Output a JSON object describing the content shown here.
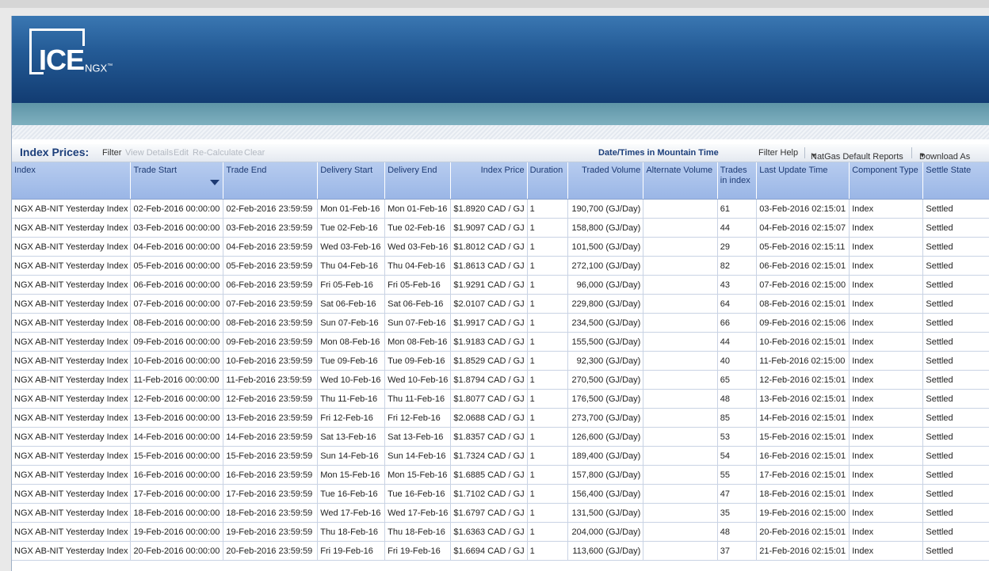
{
  "brand": {
    "name": "ICE",
    "sub": "NGX",
    "mark": "™"
  },
  "toolbar": {
    "title": "Index Prices:",
    "filter": "Filter",
    "view_details": "View Details",
    "edit": "Edit",
    "recalculate": "Re-Calculate",
    "clear": "Clear",
    "timezone_note": "Date/Times in Mountain Time",
    "filter_help": "Filter Help",
    "reports": "NatGas Default Reports",
    "download": "Download As"
  },
  "columns": [
    "Index",
    "Trade Start",
    "Trade End",
    "Delivery Start",
    "Delivery End",
    "Index Price",
    "Duration",
    "Traded Volume",
    "Alternate Volume",
    "Trades in index",
    "Last Update Time",
    "Component Type",
    "Settle State"
  ],
  "rows": [
    [
      "NGX AB-NIT Yesterday Index",
      "02-Feb-2016 00:00:00",
      "02-Feb-2016 23:59:59",
      "Mon 01-Feb-16",
      "Mon 01-Feb-16",
      "$1.8920 CAD / GJ",
      "1",
      "190,700 (GJ/Day)",
      "",
      "61",
      "03-Feb-2016 02:15:01",
      "Index",
      "Settled"
    ],
    [
      "NGX AB-NIT Yesterday Index",
      "03-Feb-2016 00:00:00",
      "03-Feb-2016 23:59:59",
      "Tue 02-Feb-16",
      "Tue 02-Feb-16",
      "$1.9097 CAD / GJ",
      "1",
      "158,800 (GJ/Day)",
      "",
      "44",
      "04-Feb-2016 02:15:07",
      "Index",
      "Settled"
    ],
    [
      "NGX AB-NIT Yesterday Index",
      "04-Feb-2016 00:00:00",
      "04-Feb-2016 23:59:59",
      "Wed 03-Feb-16",
      "Wed 03-Feb-16",
      "$1.8012 CAD / GJ",
      "1",
      "101,500 (GJ/Day)",
      "",
      "29",
      "05-Feb-2016 02:15:11",
      "Index",
      "Settled"
    ],
    [
      "NGX AB-NIT Yesterday Index",
      "05-Feb-2016 00:00:00",
      "05-Feb-2016 23:59:59",
      "Thu 04-Feb-16",
      "Thu 04-Feb-16",
      "$1.8613 CAD / GJ",
      "1",
      "272,100 (GJ/Day)",
      "",
      "82",
      "06-Feb-2016 02:15:01",
      "Index",
      "Settled"
    ],
    [
      "NGX AB-NIT Yesterday Index",
      "06-Feb-2016 00:00:00",
      "06-Feb-2016 23:59:59",
      "Fri 05-Feb-16",
      "Fri 05-Feb-16",
      "$1.9291 CAD / GJ",
      "1",
      "96,000 (GJ/Day)",
      "",
      "43",
      "07-Feb-2016 02:15:00",
      "Index",
      "Settled"
    ],
    [
      "NGX AB-NIT Yesterday Index",
      "07-Feb-2016 00:00:00",
      "07-Feb-2016 23:59:59",
      "Sat 06-Feb-16",
      "Sat 06-Feb-16",
      "$2.0107 CAD / GJ",
      "1",
      "229,800 (GJ/Day)",
      "",
      "64",
      "08-Feb-2016 02:15:01",
      "Index",
      "Settled"
    ],
    [
      "NGX AB-NIT Yesterday Index",
      "08-Feb-2016 00:00:00",
      "08-Feb-2016 23:59:59",
      "Sun 07-Feb-16",
      "Sun 07-Feb-16",
      "$1.9917 CAD / GJ",
      "1",
      "234,500 (GJ/Day)",
      "",
      "66",
      "09-Feb-2016 02:15:06",
      "Index",
      "Settled"
    ],
    [
      "NGX AB-NIT Yesterday Index",
      "09-Feb-2016 00:00:00",
      "09-Feb-2016 23:59:59",
      "Mon 08-Feb-16",
      "Mon 08-Feb-16",
      "$1.9183 CAD / GJ",
      "1",
      "155,500 (GJ/Day)",
      "",
      "44",
      "10-Feb-2016 02:15:01",
      "Index",
      "Settled"
    ],
    [
      "NGX AB-NIT Yesterday Index",
      "10-Feb-2016 00:00:00",
      "10-Feb-2016 23:59:59",
      "Tue 09-Feb-16",
      "Tue 09-Feb-16",
      "$1.8529 CAD / GJ",
      "1",
      "92,300 (GJ/Day)",
      "",
      "40",
      "11-Feb-2016 02:15:00",
      "Index",
      "Settled"
    ],
    [
      "NGX AB-NIT Yesterday Index",
      "11-Feb-2016 00:00:00",
      "11-Feb-2016 23:59:59",
      "Wed 10-Feb-16",
      "Wed 10-Feb-16",
      "$1.8794 CAD / GJ",
      "1",
      "270,500 (GJ/Day)",
      "",
      "65",
      "12-Feb-2016 02:15:01",
      "Index",
      "Settled"
    ],
    [
      "NGX AB-NIT Yesterday Index",
      "12-Feb-2016 00:00:00",
      "12-Feb-2016 23:59:59",
      "Thu 11-Feb-16",
      "Thu 11-Feb-16",
      "$1.8077 CAD / GJ",
      "1",
      "176,500 (GJ/Day)",
      "",
      "48",
      "13-Feb-2016 02:15:01",
      "Index",
      "Settled"
    ],
    [
      "NGX AB-NIT Yesterday Index",
      "13-Feb-2016 00:00:00",
      "13-Feb-2016 23:59:59",
      "Fri 12-Feb-16",
      "Fri 12-Feb-16",
      "$2.0688 CAD / GJ",
      "1",
      "273,700 (GJ/Day)",
      "",
      "85",
      "14-Feb-2016 02:15:01",
      "Index",
      "Settled"
    ],
    [
      "NGX AB-NIT Yesterday Index",
      "14-Feb-2016 00:00:00",
      "14-Feb-2016 23:59:59",
      "Sat 13-Feb-16",
      "Sat 13-Feb-16",
      "$1.8357 CAD / GJ",
      "1",
      "126,600 (GJ/Day)",
      "",
      "53",
      "15-Feb-2016 02:15:01",
      "Index",
      "Settled"
    ],
    [
      "NGX AB-NIT Yesterday Index",
      "15-Feb-2016 00:00:00",
      "15-Feb-2016 23:59:59",
      "Sun 14-Feb-16",
      "Sun 14-Feb-16",
      "$1.7324 CAD / GJ",
      "1",
      "189,400 (GJ/Day)",
      "",
      "54",
      "16-Feb-2016 02:15:01",
      "Index",
      "Settled"
    ],
    [
      "NGX AB-NIT Yesterday Index",
      "16-Feb-2016 00:00:00",
      "16-Feb-2016 23:59:59",
      "Mon 15-Feb-16",
      "Mon 15-Feb-16",
      "$1.6885 CAD / GJ",
      "1",
      "157,800 (GJ/Day)",
      "",
      "55",
      "17-Feb-2016 02:15:01",
      "Index",
      "Settled"
    ],
    [
      "NGX AB-NIT Yesterday Index",
      "17-Feb-2016 00:00:00",
      "17-Feb-2016 23:59:59",
      "Tue 16-Feb-16",
      "Tue 16-Feb-16",
      "$1.7102 CAD / GJ",
      "1",
      "156,400 (GJ/Day)",
      "",
      "47",
      "18-Feb-2016 02:15:01",
      "Index",
      "Settled"
    ],
    [
      "NGX AB-NIT Yesterday Index",
      "18-Feb-2016 00:00:00",
      "18-Feb-2016 23:59:59",
      "Wed 17-Feb-16",
      "Wed 17-Feb-16",
      "$1.6797 CAD / GJ",
      "1",
      "131,500 (GJ/Day)",
      "",
      "35",
      "19-Feb-2016 02:15:00",
      "Index",
      "Settled"
    ],
    [
      "NGX AB-NIT Yesterday Index",
      "19-Feb-2016 00:00:00",
      "19-Feb-2016 23:59:59",
      "Thu 18-Feb-16",
      "Thu 18-Feb-16",
      "$1.6363 CAD / GJ",
      "1",
      "204,000 (GJ/Day)",
      "",
      "48",
      "20-Feb-2016 02:15:01",
      "Index",
      "Settled"
    ],
    [
      "NGX AB-NIT Yesterday Index",
      "20-Feb-2016 00:00:00",
      "20-Feb-2016 23:59:59",
      "Fri 19-Feb-16",
      "Fri 19-Feb-16",
      "$1.6694 CAD / GJ",
      "1",
      "113,600 (GJ/Day)",
      "",
      "37",
      "21-Feb-2016 02:15:01",
      "Index",
      "Settled"
    ]
  ],
  "sort": {
    "column": "Trade Start",
    "direction": "descending"
  },
  "colors": {
    "header_blue": "#245b96",
    "column_header": "#a9c2ec",
    "toolbar_title": "#1b3e7a"
  }
}
